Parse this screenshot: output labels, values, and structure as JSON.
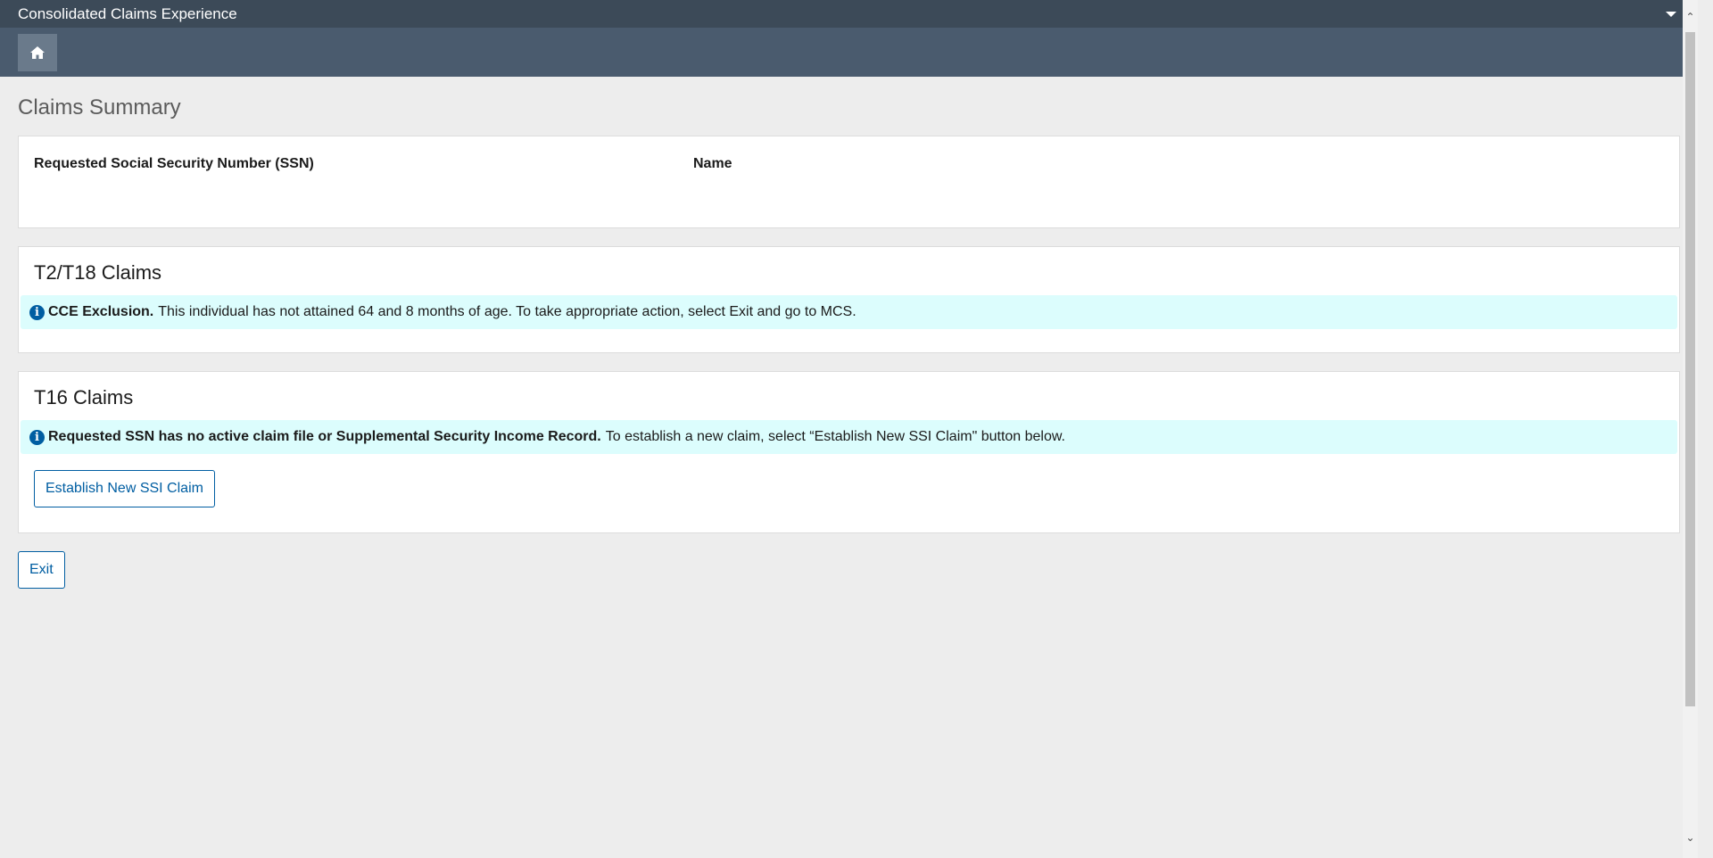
{
  "app": {
    "title": "Consolidated Claims Experience",
    "menu_icon": "caret-down-icon",
    "home_icon": "home-icon"
  },
  "page": {
    "title": "Claims Summary"
  },
  "summary": {
    "ssn_label": "Requested Social Security Number (SSN)",
    "name_label": "Name"
  },
  "t2t18": {
    "title": "T2/T18 Claims",
    "alert_bold": "CCE Exclusion.",
    "alert_text": "This individual has not attained 64 and 8 months of age. To take appropriate action, select Exit and go to MCS."
  },
  "t16": {
    "title": "T16 Claims",
    "alert_bold": "Requested SSN has no active claim file or Supplemental Security Income Record.",
    "alert_text": "To establish a new claim, select “Establish New SSI Claim\" button below.",
    "establish_button": "Establish New SSI Claim"
  },
  "footer": {
    "exit_button": "Exit"
  },
  "colors": {
    "titlebar": "#3c4a58",
    "navbar": "#4a5b6e",
    "alert_bg": "#dcfdfd",
    "primary": "#005ea2"
  }
}
